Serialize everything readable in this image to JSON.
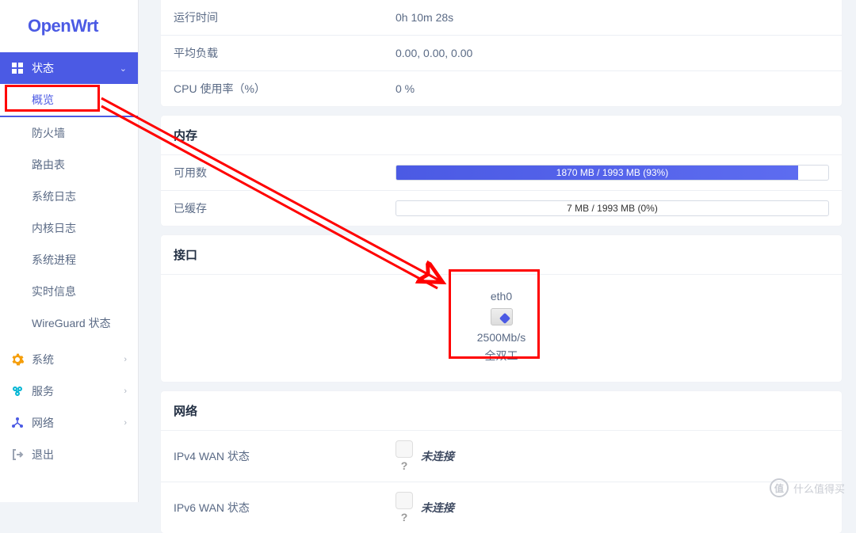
{
  "brand": "OpenWrt",
  "sidebar": {
    "status": {
      "label": "状态"
    },
    "sub": {
      "overview": "概览",
      "firewall": "防火墙",
      "routes": "路由表",
      "syslog": "系统日志",
      "kernellog": "内核日志",
      "processes": "系统进程",
      "realtime": "实时信息",
      "wireguard": "WireGuard 状态"
    },
    "system": {
      "label": "系统"
    },
    "services": {
      "label": "服务"
    },
    "network": {
      "label": "网络"
    },
    "logout": {
      "label": "退出"
    }
  },
  "status_rows": {
    "uptime": {
      "label": "运行时间",
      "value": "0h 10m 28s"
    },
    "load": {
      "label": "平均负载",
      "value": "0.00, 0.00, 0.00"
    },
    "cpu": {
      "label": "CPU 使用率（%）",
      "value": "0 %"
    }
  },
  "memory": {
    "header": "内存",
    "available": {
      "label": "可用数",
      "text": "1870 MB / 1993 MB (93%)",
      "percent": 93
    },
    "cached": {
      "label": "已缓存",
      "text": "7 MB / 1993 MB (0%)",
      "percent": 0
    }
  },
  "interfaces": {
    "header": "接口",
    "eth0": {
      "name": "eth0",
      "speed": "2500Mb/s",
      "duplex": "全双工"
    }
  },
  "network_section": {
    "header": "网络",
    "ipv4": {
      "label": "IPv4 WAN 状态",
      "q": "?",
      "status": "未连接"
    },
    "ipv6": {
      "label": "IPv6 WAN 状态",
      "q": "?",
      "status": "未连接"
    }
  },
  "watermark": {
    "symbol": "值",
    "text": "什么值得买"
  }
}
